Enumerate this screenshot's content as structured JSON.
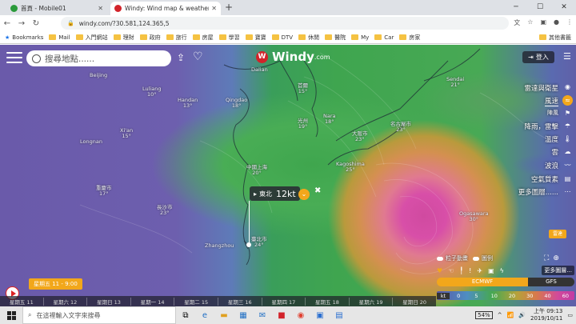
{
  "browser": {
    "tabs": [
      {
        "title": "首頁 - Mobile01",
        "active": false,
        "fav_color": "#2a9a3a"
      },
      {
        "title": "Windy: Wind map & weather f…",
        "active": true,
        "fav_color": "#d2232a"
      }
    ],
    "url": "windy.com/?30.581,124.365,5",
    "bookmarks": [
      "Bookmarks",
      "Mail",
      "入門網站",
      "理財",
      "政府",
      "旅行",
      "房屋",
      "學習",
      "寶寶",
      "DTV",
      "休閒",
      "醫院",
      "My",
      "Car",
      "房家",
      "其他書籤"
    ]
  },
  "app": {
    "search_placeholder": "搜尋地點......",
    "logo_text": "Windy",
    "logo_suffix": ".com",
    "login_label": "登入",
    "layers": [
      {
        "label": "雷達與衛星",
        "selected": false
      },
      {
        "label": "風速",
        "selected": true
      },
      {
        "label": "陣風",
        "selected": false
      },
      {
        "label": "降雨，雷擊",
        "selected": false
      },
      {
        "label": "溫度",
        "selected": false
      },
      {
        "label": "雲",
        "selected": false
      },
      {
        "label": "波浪",
        "selected": false
      },
      {
        "label": "空氣質素",
        "selected": false
      },
      {
        "label": "更多圖層......",
        "selected": false
      }
    ],
    "cities": [
      {
        "name": "Beijing",
        "temp": ""
      },
      {
        "name": "Dalian",
        "temp": ""
      },
      {
        "name": "首爾",
        "temp": "15°"
      },
      {
        "name": "Sendai",
        "temp": "21°"
      },
      {
        "name": "Luliang",
        "temp": "10°"
      },
      {
        "name": "Handan",
        "temp": "13°"
      },
      {
        "name": "Qingdao",
        "temp": "18°"
      },
      {
        "name": "光州",
        "temp": "19°"
      },
      {
        "name": "大阪市",
        "temp": "23°"
      },
      {
        "name": "名古屋市",
        "temp": "23°"
      },
      {
        "name": "Nara",
        "temp": "18°"
      },
      {
        "name": "Xi'an",
        "temp": "15°"
      },
      {
        "name": "Longnan",
        "temp": ""
      },
      {
        "name": "Kagoshima",
        "temp": "25°"
      },
      {
        "name": "中國上海",
        "temp": "20°"
      },
      {
        "name": "重慶市",
        "temp": "17°"
      },
      {
        "name": "長沙市",
        "temp": "23°"
      },
      {
        "name": "Zhangzhou",
        "temp": ""
      },
      {
        "name": "臺北市",
        "temp": "24°"
      },
      {
        "name": "Ogasawara",
        "temp": "30°"
      }
    ],
    "picker": {
      "direction": "東北",
      "speed": "12kt"
    },
    "radar_button": "雷達",
    "options": [
      "粒子動畫",
      "圖例"
    ],
    "more_label": "更多圖層...",
    "models": {
      "active": "ECMWF",
      "other": "GFS"
    },
    "legend": {
      "unit": "kt",
      "values": [
        "0",
        "5",
        "10",
        "20",
        "30",
        "40",
        "60"
      ]
    },
    "current_time": "星期五 11 - 9:00",
    "timeline": [
      "星期五 11",
      "星期六 12",
      "星期日 13",
      "星期一 14",
      "星期二 15",
      "星期三 16",
      "星期四 17",
      "星期五 18",
      "星期六 19",
      "星期日 20"
    ],
    "accent_color": "#f2a71b"
  },
  "taskbar": {
    "search_placeholder": "在這裡輸入文字來搜尋",
    "battery": "54%",
    "time": "上午 09:13",
    "date": "2019/10/11"
  }
}
